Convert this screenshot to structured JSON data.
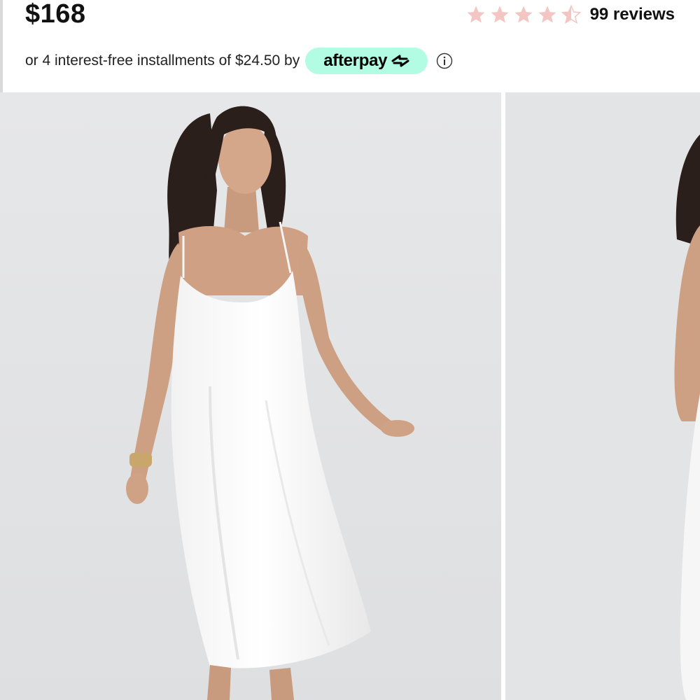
{
  "product": {
    "price": "$168"
  },
  "rating": {
    "value": 4.5,
    "max": 5,
    "star_color": "#f4c6c3",
    "review_count_label": "99 reviews"
  },
  "payment": {
    "installments_text": "or 4 interest-free installments of $24.50 by",
    "provider_label": "afterpay",
    "provider_color": "#b2fce4",
    "info_icon": "info-circle-icon"
  },
  "gallery": {
    "background_color": "#e3e4e6",
    "images": [
      {
        "name": "product-photo-front",
        "subject": "model in white satin slip dress"
      },
      {
        "name": "product-photo-side",
        "subject": "model in white satin slip dress, partial view"
      }
    ]
  }
}
